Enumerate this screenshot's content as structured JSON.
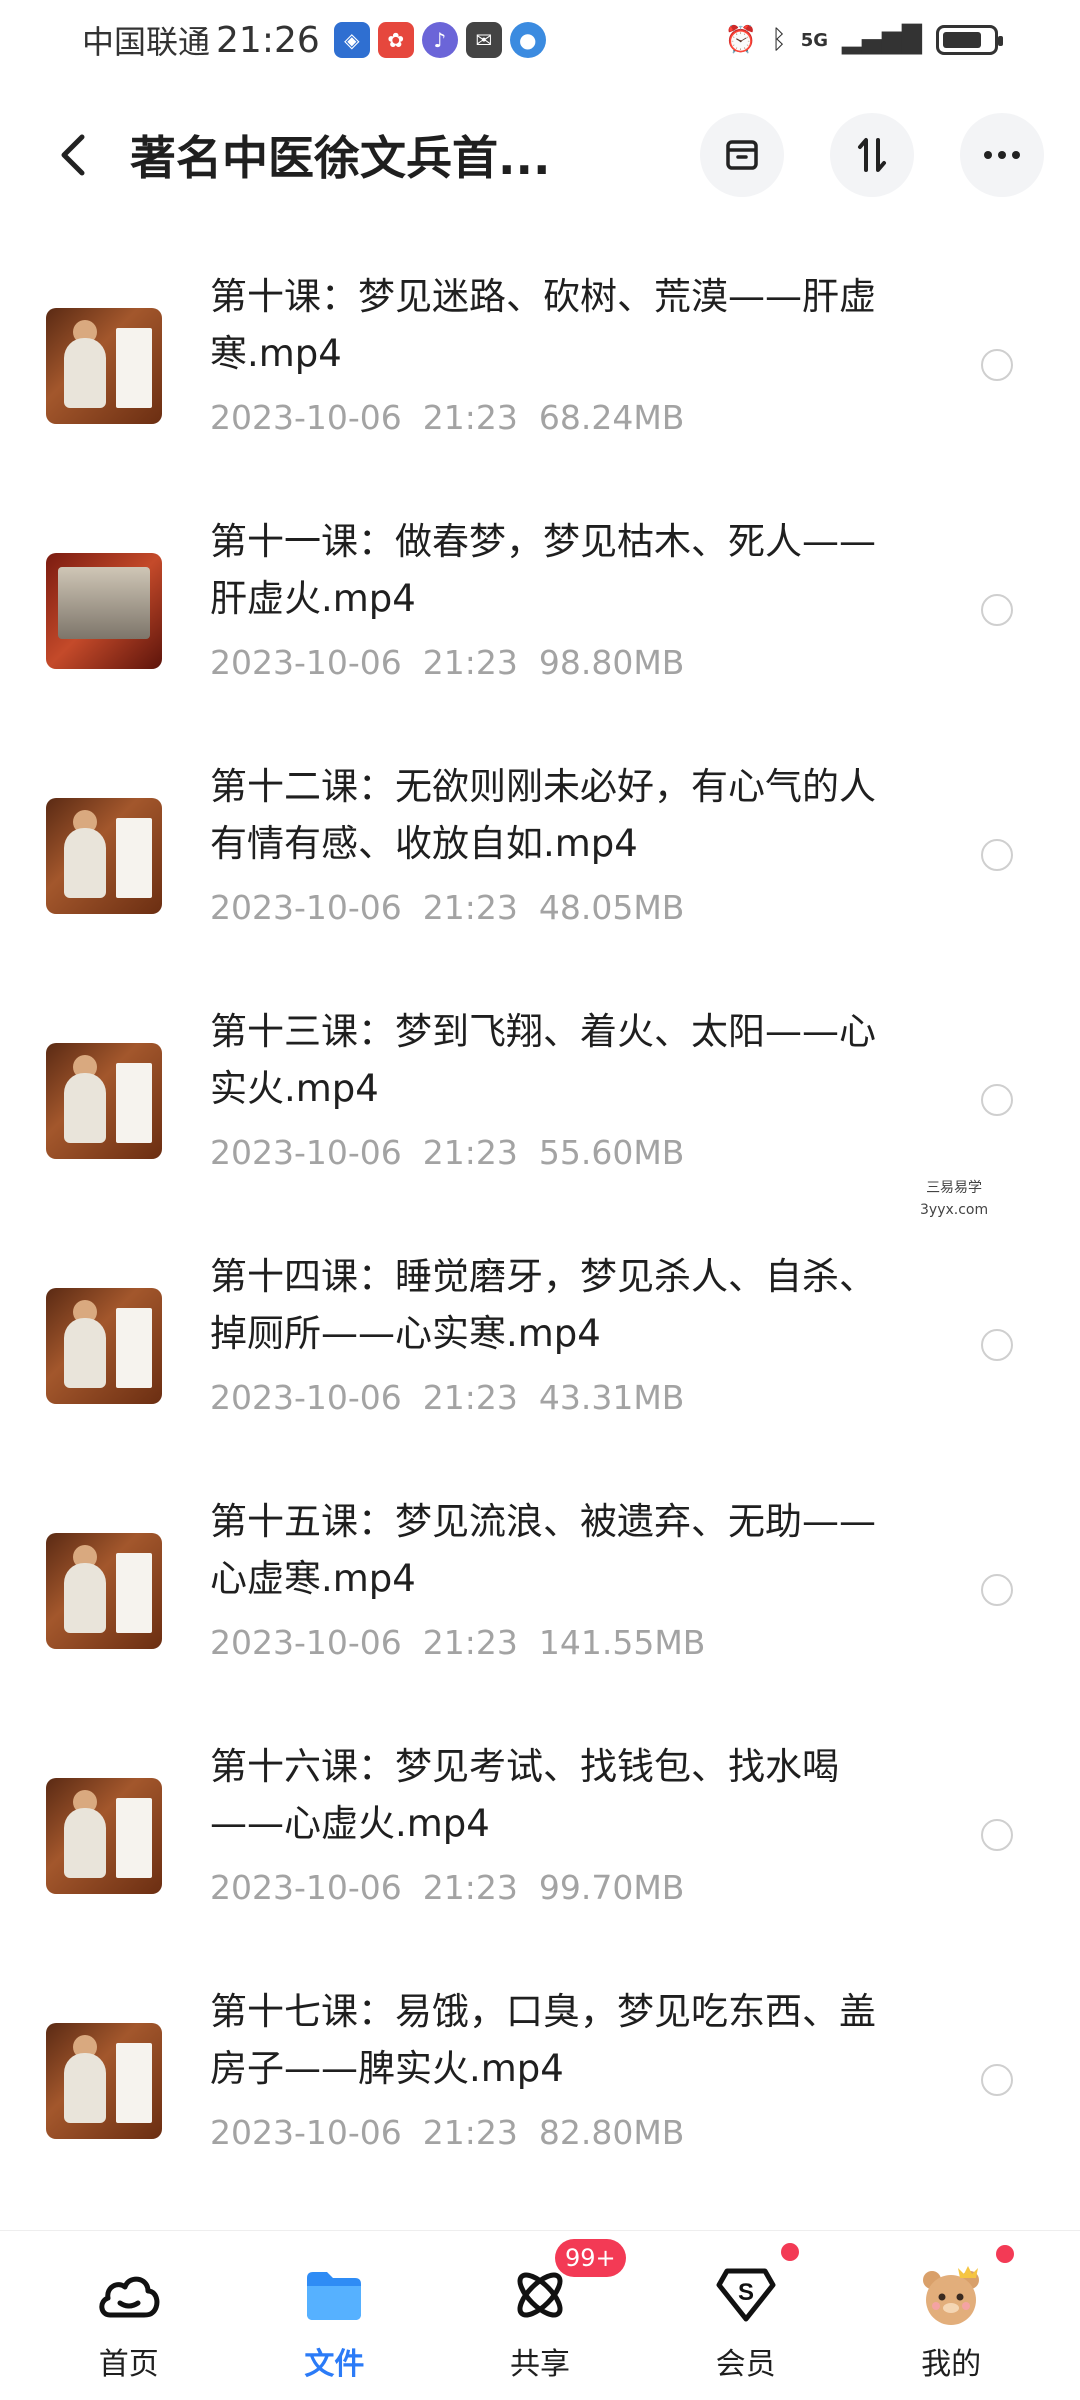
{
  "status_bar": {
    "carrier": "中国联通",
    "time": "21:26",
    "signal_label": "5G"
  },
  "header": {
    "title": "著名中医徐文兵首..."
  },
  "files": [
    {
      "name": "第十课：梦见迷路、砍树、荒漠——肝虚寒.mp4",
      "date": "2023-10-06",
      "time": "21:23",
      "size": "68.24MB"
    },
    {
      "name": "第十一课：做春梦，梦见枯木、死人——肝虚火.mp4",
      "date": "2023-10-06",
      "time": "21:23",
      "size": "98.80MB"
    },
    {
      "name": "第十二课：无欲则刚未必好，有心气的人有情有感、收放自如.mp4",
      "date": "2023-10-06",
      "time": "21:23",
      "size": "48.05MB"
    },
    {
      "name": "第十三课：梦到飞翔、着火、太阳——心实火.mp4",
      "date": "2023-10-06",
      "time": "21:23",
      "size": "55.60MB"
    },
    {
      "name": "第十四课：睡觉磨牙，梦见杀人、自杀、掉厕所——心实寒.mp4",
      "date": "2023-10-06",
      "time": "21:23",
      "size": "43.31MB"
    },
    {
      "name": "第十五课：梦见流浪、被遗弃、无助——心虚寒.mp4",
      "date": "2023-10-06",
      "time": "21:23",
      "size": "141.55MB"
    },
    {
      "name": "第十六课：梦见考试、找钱包、找水喝——心虚火.mp4",
      "date": "2023-10-06",
      "time": "21:23",
      "size": "99.70MB"
    },
    {
      "name": "第十七课：易饿，口臭，梦见吃东西、盖房子——脾实火.mp4",
      "date": "2023-10-06",
      "time": "21:23",
      "size": "82.80MB"
    }
  ],
  "watermark": {
    "line1": "三易易学",
    "line2": "3yyx.com"
  },
  "tabs": [
    {
      "label": "首页",
      "icon": "home-cloud-icon"
    },
    {
      "label": "文件",
      "icon": "folder-icon"
    },
    {
      "label": "共享",
      "icon": "share-orbit-icon",
      "badge": "99+"
    },
    {
      "label": "会员",
      "icon": "vip-diamond-icon"
    },
    {
      "label": "我的",
      "icon": "bear-avatar-icon"
    }
  ],
  "colors": {
    "accent": "#2b7bf7",
    "badge": "#f33a55",
    "meta_text": "#a3a3a3"
  }
}
